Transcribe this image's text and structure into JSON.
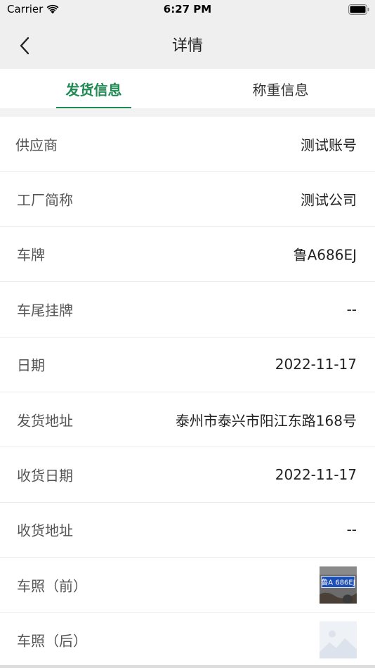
{
  "status_bar": {
    "carrier": "Carrier",
    "time": "6:27 PM"
  },
  "nav": {
    "title": "详情",
    "back_icon": "chevron-left-icon"
  },
  "tabs": [
    {
      "label": "发货信息",
      "active": true
    },
    {
      "label": "称重信息",
      "active": false
    }
  ],
  "details": [
    {
      "label": "供应商",
      "value": "测试账号"
    },
    {
      "label": "工厂简称",
      "value": "测试公司"
    },
    {
      "label": "车牌",
      "value": "鲁A686EJ"
    },
    {
      "label": "车尾挂牌",
      "value": "--"
    },
    {
      "label": "日期",
      "value": "2022-11-17"
    },
    {
      "label": "发货地址",
      "value": "泰州市泰兴市阳江东路168号"
    },
    {
      "label": "收货日期",
      "value": "2022-11-17"
    },
    {
      "label": "收货地址",
      "value": "--"
    }
  ],
  "photos": [
    {
      "label": "车照（前）",
      "plate_text": "鲁A 686EJ"
    },
    {
      "label": "车照（后）"
    }
  ],
  "colors": {
    "accent": "#1f8a52",
    "header_bg": "#efefef",
    "plate_blue": "#1e4fb5"
  }
}
